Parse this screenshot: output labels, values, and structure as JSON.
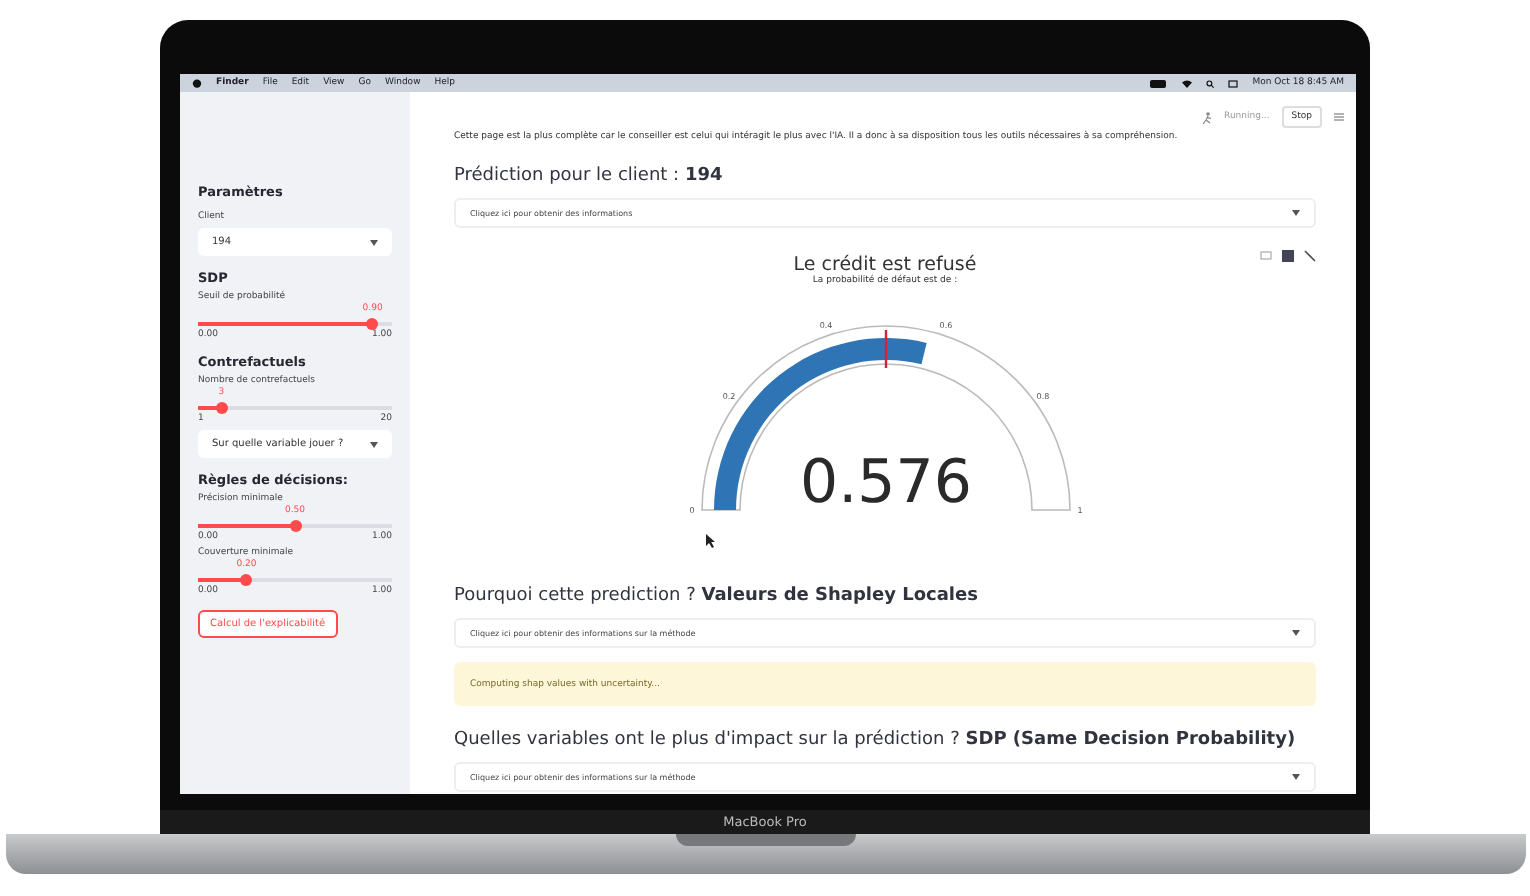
{
  "menu_bar": {
    "items": [
      {
        "label": "Finder",
        "kind": "app"
      },
      {
        "label": "File",
        "kind": "menu"
      },
      {
        "label": "Edit",
        "kind": "menu"
      },
      {
        "label": "View",
        "kind": "menu"
      },
      {
        "label": "Go",
        "kind": "menu"
      },
      {
        "label": "Window",
        "kind": "menu"
      },
      {
        "label": "Help",
        "kind": "menu"
      }
    ],
    "clock": "Mon Oct 18 8:45 AM"
  },
  "sidebar": {
    "title": "Paramètres",
    "sections": [
      {
        "kind": "select",
        "label": "Client",
        "value": "194"
      },
      {
        "kind": "heading",
        "label": "SDP"
      },
      {
        "kind": "slider",
        "label": "Seuil de probabilité",
        "value": "0.90",
        "level": 0.9,
        "min": "0.00",
        "max": "1.00"
      },
      {
        "kind": "heading",
        "label": "Contrefactuels"
      },
      {
        "kind": "slider",
        "label": "Nombre de contrefactuels",
        "value": "3",
        "level": 0.12,
        "min": "1",
        "max": "20"
      },
      {
        "kind": "select",
        "value": "Sur quelle variable jouer ?"
      },
      {
        "kind": "heading",
        "label": "Règles de décisions:"
      },
      {
        "kind": "slider",
        "label": "Précision minimale",
        "value": "0.50",
        "level": 0.5,
        "min": "0.00",
        "max": "1.00"
      },
      {
        "kind": "slider",
        "label": "Couverture minimale",
        "value": "0.20",
        "level": 0.25,
        "min": "0.00",
        "max": "1.00"
      },
      {
        "kind": "button",
        "label": "Calcul de l'explicabilité"
      }
    ]
  },
  "header": {
    "status": "Running...",
    "stop": "Stop"
  },
  "intro": [
    "Cette page est la plus complète car le conseiller est celui qui intéragit le plus avec l'IA. Il a donc à sa disposition tous les outils nécessaires à sa compréhension."
  ],
  "prediction": {
    "heading": "Prédiction pour le client : **194**",
    "expander": "Cliquez ici pour obtenir des informations"
  },
  "gauge": {
    "title": "Le crédit est refusé",
    "subtitle": "La probabilité de défaut est de :",
    "value": "0.576",
    "level": 0.576,
    "threshold": {
      "level": 0.5
    },
    "ticks": [
      "0",
      "0.2",
      "0.4",
      "0.6",
      "0.8",
      "1"
    ]
  },
  "shap": {
    "heading": "Pourquoi cette prediction ? **Valeurs de Shapley Locales**",
    "expander": "Cliquez ici pour obtenir des informations sur la méthode",
    "alert": "Computing shap values with uncertainty..."
  },
  "sdp": {
    "heading": "Quelles variables ont le plus d'impact sur la prédiction ? **SDP (Same Decision Probability)**",
    "expander": "Cliquez ici pour obtenir des informations sur la méthode"
  },
  "device": {
    "label": "MacBook Pro"
  }
}
